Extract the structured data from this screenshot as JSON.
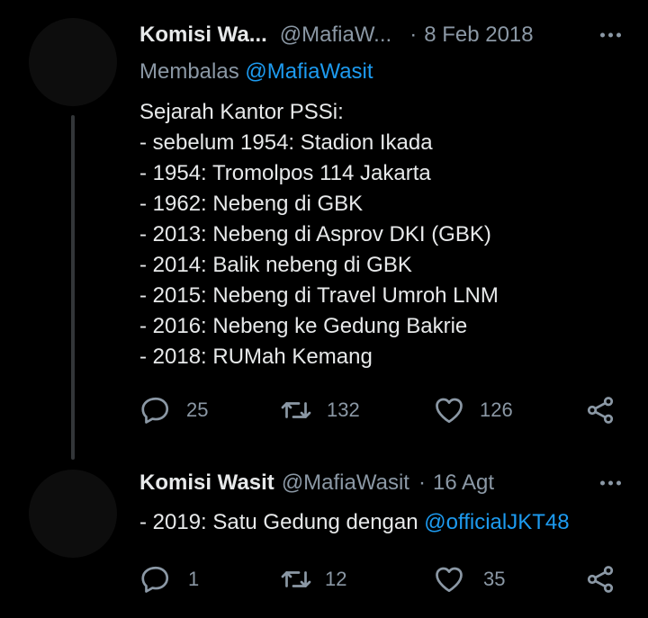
{
  "tweets": [
    {
      "name": "Komisi Wa...",
      "handle": "@MafiaW...",
      "dot": "·",
      "date": "8 Feb 2018",
      "reply_prefix": "Membalas",
      "reply_mention": "@MafiaWasit",
      "lines": [
        "Sejarah Kantor PSSi:",
        "- sebelum 1954: Stadion Ikada",
        "- 1954: Tromolpos 114 Jakarta",
        "- 1962: Nebeng di GBK",
        "- 2013: Nebeng di Asprov DKI (GBK)",
        "- 2014: Balik nebeng di GBK",
        "- 2015: Nebeng di Travel Umroh LNM",
        "- 2016: Nebeng ke Gedung Bakrie",
        "- 2018: RUMah Kemang"
      ],
      "reply_count": "25",
      "retweet_count": "132",
      "like_count": "126"
    },
    {
      "name": "Komisi Wasit",
      "handle": "@MafiaWasit",
      "dot": "·",
      "date": "16 Agt",
      "text_prefix": "- 2019: Satu Gedung dengan ",
      "text_mention": "@officialJKT48",
      "reply_count": "1",
      "retweet_count": "12",
      "like_count": "35"
    }
  ],
  "icons": {
    "reply": "reply-icon",
    "retweet": "retweet-icon",
    "like": "heart-icon",
    "share": "share-icon",
    "more": "more-icon"
  },
  "colors": {
    "background": "#000000",
    "text": "#e7e9ea",
    "secondary": "#8b98a5",
    "link": "#1d9bf0",
    "thread_line": "#333639"
  }
}
